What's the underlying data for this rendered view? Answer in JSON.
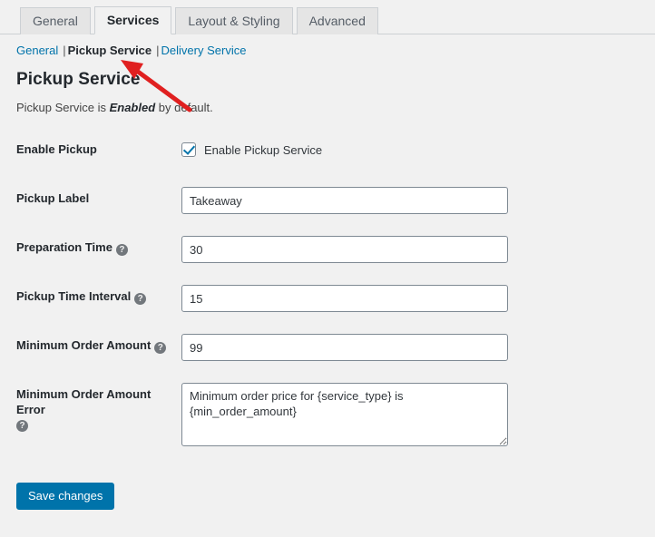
{
  "tabs": [
    {
      "label": "General",
      "active": false
    },
    {
      "label": "Services",
      "active": true
    },
    {
      "label": "Layout & Styling",
      "active": false
    },
    {
      "label": "Advanced",
      "active": false
    }
  ],
  "subnav": {
    "items": [
      {
        "label": "General",
        "current": false
      },
      {
        "label": "Pickup Service",
        "current": true
      },
      {
        "label": "Delivery Service",
        "current": false
      }
    ],
    "separator": "|"
  },
  "heading": {
    "title": "Pickup Service",
    "description_prefix": "Pickup Service is ",
    "description_emphasis": "Enabled",
    "description_suffix": " by default."
  },
  "fields": {
    "enable_pickup": {
      "label": "Enable Pickup",
      "checkbox_label": "Enable Pickup Service",
      "checked": true
    },
    "pickup_label": {
      "label": "Pickup Label",
      "value": "Takeaway"
    },
    "preparation_time": {
      "label": "Preparation Time",
      "value": "30",
      "help": "?"
    },
    "pickup_time_interval": {
      "label": "Pickup Time Interval",
      "value": "15",
      "help": "?"
    },
    "minimum_order_amount": {
      "label": "Minimum Order Amount",
      "value": "99",
      "help": "?"
    },
    "minimum_order_amount_error": {
      "label": "Minimum Order Amount Error",
      "value": "Minimum order price for {service_type} is {min_order_amount}",
      "help": "?"
    }
  },
  "submit": {
    "label": "Save changes"
  },
  "annotation": {
    "type": "arrow",
    "color": "#e02020",
    "points_to": "Pickup Service sub-navigation link"
  },
  "colors": {
    "accent": "#0073aa",
    "link": "#0073aa",
    "page_background": "#f1f1f1",
    "tab_inactive": "#e5e5e5",
    "border": "#ccd0d4",
    "input_border": "#7e8993",
    "annotation_red": "#e02020"
  }
}
